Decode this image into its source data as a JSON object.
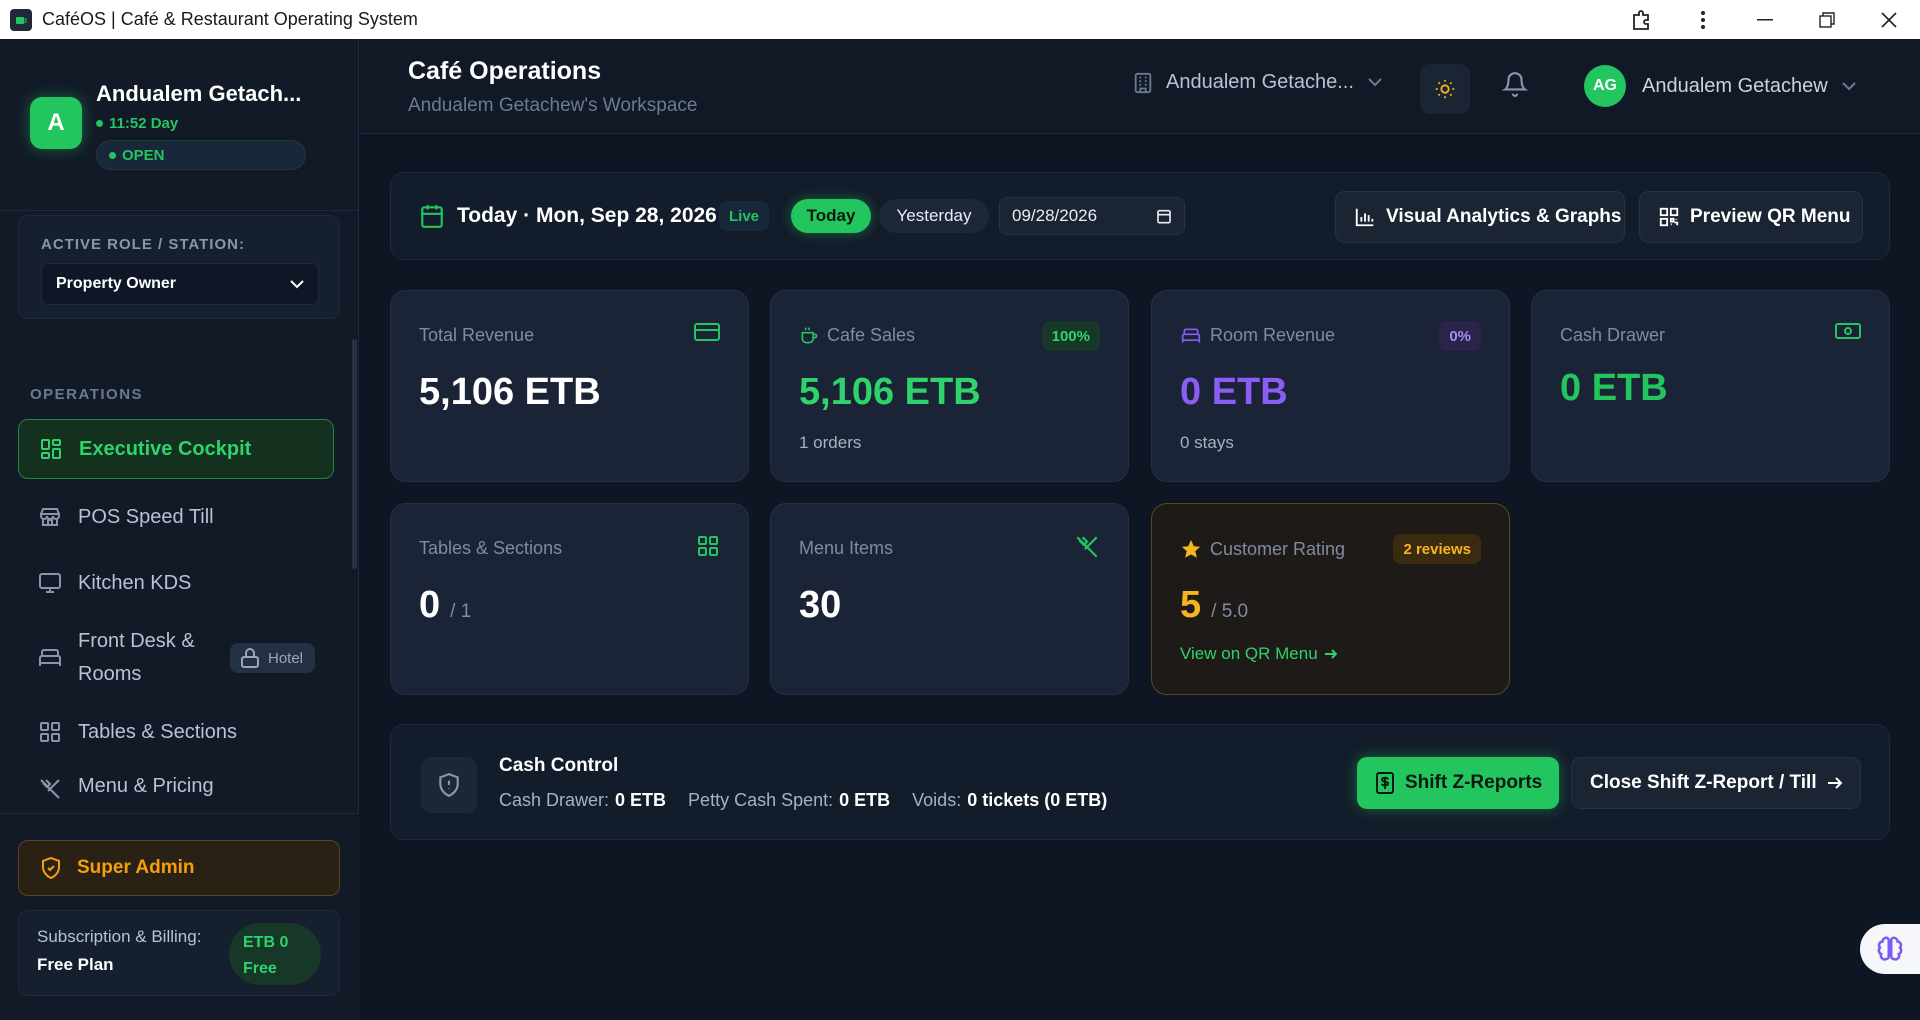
{
  "window": {
    "title": "CaféOS | Café & Restaurant Operating System"
  },
  "sidebar": {
    "brand": {
      "avatar_letter": "A",
      "name": "Andualem Getach...",
      "time": "11:52 Day",
      "status": "OPEN"
    },
    "role": {
      "label": "ACTIVE ROLE / STATION:",
      "selected": "Property Owner"
    },
    "section_label": "OPERATIONS",
    "items": [
      {
        "label": "Executive Cockpit",
        "icon": "grid-icon",
        "active": true
      },
      {
        "label": "POS Speed Till",
        "icon": "store-icon"
      },
      {
        "label": "Kitchen KDS",
        "icon": "monitor-icon"
      },
      {
        "label": "Front Desk &\nRooms",
        "icon": "bed-icon",
        "badge": "Hotel"
      },
      {
        "label": "Tables & Sections",
        "icon": "grid-icon"
      },
      {
        "label": "Menu & Pricing",
        "icon": "utensils-icon"
      }
    ],
    "super_admin": "Super Admin",
    "subscription": {
      "label": "Subscription & Billing:",
      "plan": "Free Plan",
      "badge_line1": "ETB 0",
      "badge_line2": "Free"
    }
  },
  "header": {
    "title": "Café Operations",
    "subtitle": "Andualem Getachew's Workspace",
    "workspace": "Andualem Getache...",
    "user_initials": "AG",
    "user_name": "Andualem Getachew"
  },
  "datebar": {
    "date_text": "Today · Mon, Sep 28, 2026",
    "live": "Live",
    "today": "Today",
    "yesterday": "Yesterday",
    "date_value": "09/28/2026",
    "analytics_btn": "Visual Analytics & Graphs",
    "qr_btn": "Preview QR Menu"
  },
  "stats": {
    "total_revenue": {
      "label": "Total Revenue",
      "value": "5,106 ETB"
    },
    "cafe_sales": {
      "label": "Cafe Sales",
      "value": "5,106 ETB",
      "badge": "100%",
      "sub": "1 orders"
    },
    "room_revenue": {
      "label": "Room Revenue",
      "value": "0 ETB",
      "badge": "0%",
      "sub": "0 stays"
    },
    "cash_drawer": {
      "label": "Cash Drawer",
      "value": "0 ETB"
    },
    "tables": {
      "label": "Tables & Sections",
      "value": "0",
      "of": "/ 1"
    },
    "menu_items": {
      "label": "Menu Items",
      "value": "30"
    },
    "rating": {
      "label": "Customer Rating",
      "badge": "2 reviews",
      "value": "5",
      "of": "/ 5.0",
      "link": "View on QR Menu"
    }
  },
  "cash_control": {
    "title": "Cash Control",
    "drawer_label": "Cash Drawer:",
    "drawer_value": "0 ETB",
    "petty_label": "Petty Cash Spent:",
    "petty_value": "0 ETB",
    "voids_label": "Voids:",
    "voids_value": "0 tickets (0 ETB)",
    "zreports_btn": "Shift Z-Reports",
    "close_btn": "Close Shift Z-Report / Till"
  },
  "colors": {
    "accent_green": "#22c55e",
    "purple": "#8b5cf6",
    "amber": "#f5b51f",
    "background": "#0f1623"
  }
}
